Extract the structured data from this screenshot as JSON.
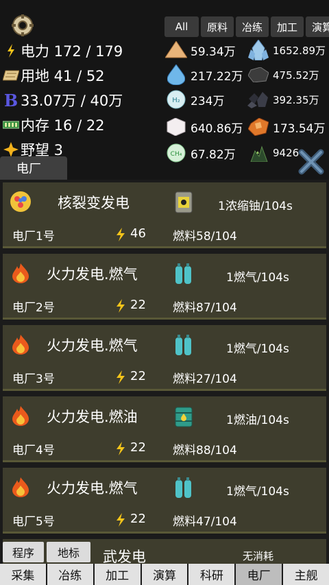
{
  "stats": {
    "power": "电力 172 / 179",
    "land": "用地 41 / 52",
    "money": "33.07万 / 40万",
    "storage": "内存 16 / 22",
    "ambition": "野望 3",
    "money_badge": "B"
  },
  "section_tab": "电厂",
  "filters": [
    "All",
    "原料",
    "冶练",
    "加工",
    "演算"
  ],
  "resources": {
    "sand": "59.34万",
    "crystal": "1652.89万",
    "water": "217.22万",
    "coal": "475.52万",
    "hydrogen": "234万",
    "hydrogen_label": "H₂",
    "ore_dark": "392.35万",
    "salt": "640.86万",
    "copper": "173.54万",
    "methane": "67.82万",
    "methane_label": "CH₄",
    "mineral_green": "9426"
  },
  "plants": [
    {
      "title": "核裂变发电",
      "fuel_consume": "1浓缩铀/104s",
      "name": "电厂1号",
      "power": "46",
      "fuel": "燃料58/104"
    },
    {
      "title": "火力发电.燃气",
      "fuel_consume": "1燃气/104s",
      "name": "电厂2号",
      "power": "22",
      "fuel": "燃料87/104"
    },
    {
      "title": "火力发电.燃气",
      "fuel_consume": "1燃气/104s",
      "name": "电厂3号",
      "power": "22",
      "fuel": "燃料27/104"
    },
    {
      "title": "火力发电.燃油",
      "fuel_consume": "1燃油/104s",
      "name": "电厂4号",
      "power": "22",
      "fuel": "燃料88/104"
    },
    {
      "title": "火力发电.燃气",
      "fuel_consume": "1燃气/104s",
      "name": "电厂5号",
      "power": "22",
      "fuel": "燃料47/104"
    }
  ],
  "partial_title": "武发电",
  "partial_fuel": "无消耗",
  "mini_buttons": {
    "order": "程序",
    "landmark": "地标"
  },
  "nav": [
    "采集",
    "冶练",
    "加工",
    "演算",
    "科研",
    "电厂",
    "主舰"
  ],
  "colors": {
    "card_bg": "#3e3d2d",
    "bolt": "#f4c41a",
    "nav_bg": "#e2e2e2"
  }
}
